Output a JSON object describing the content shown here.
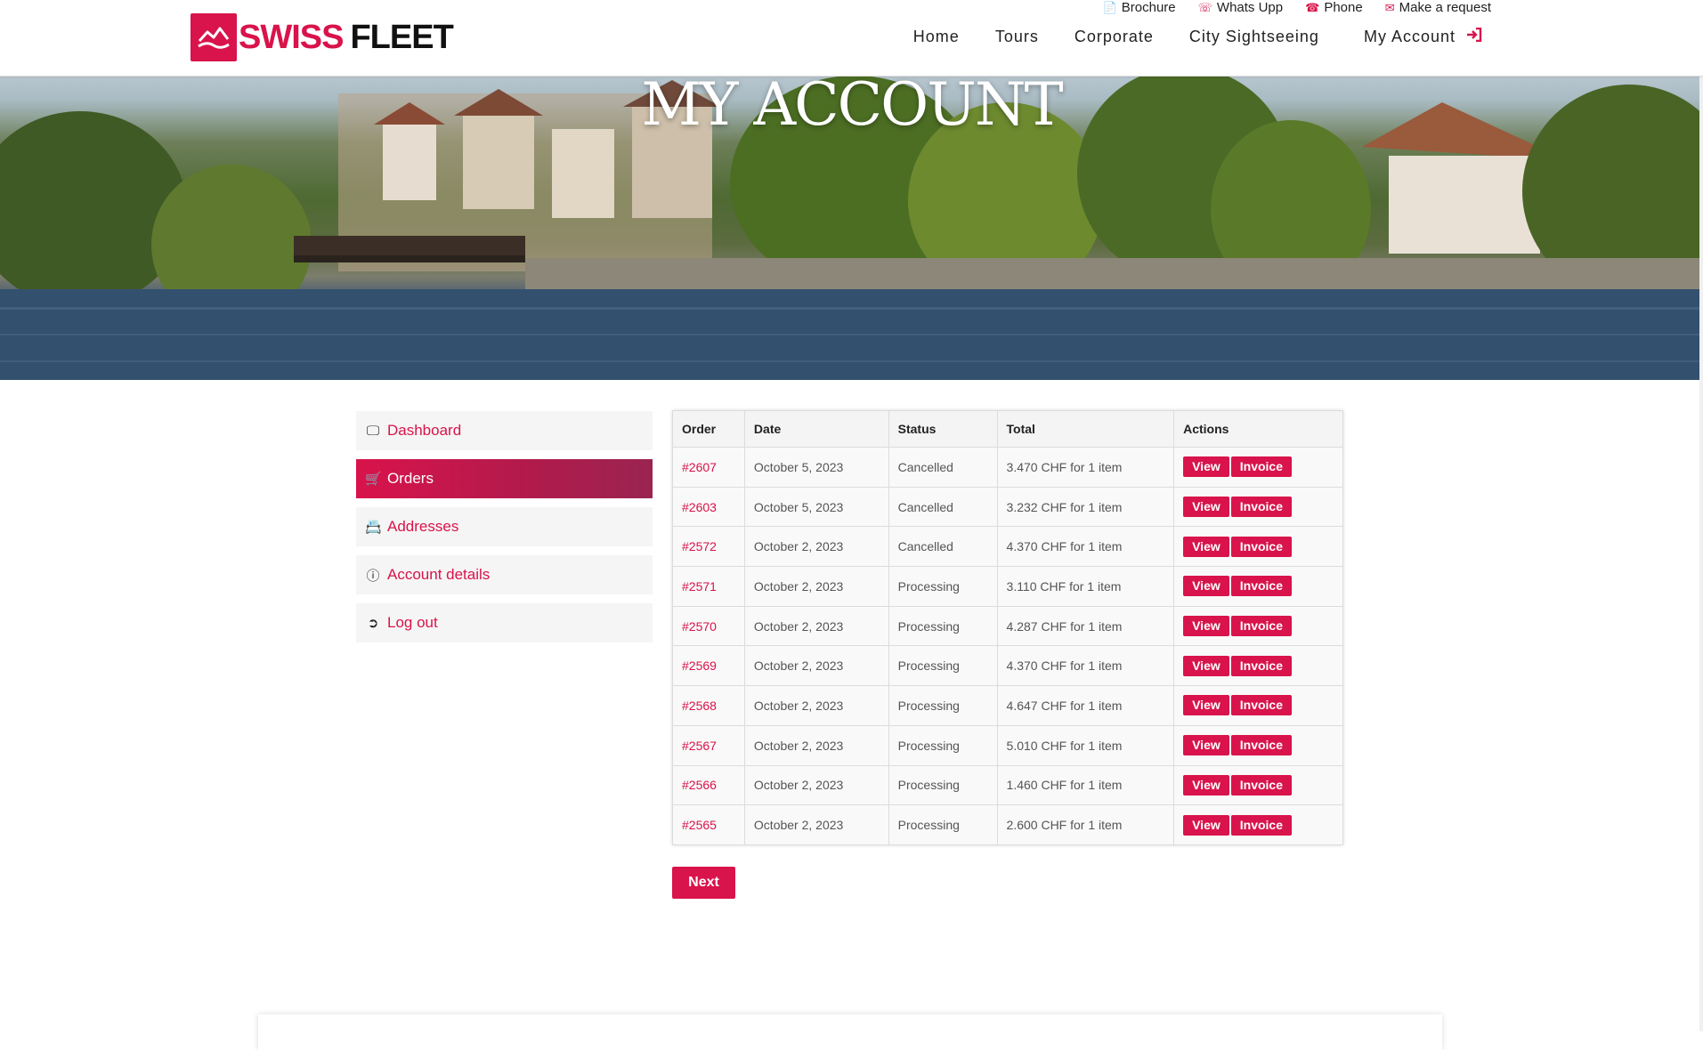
{
  "brand": {
    "part1": "SWISS",
    "part2": "FLEET",
    "color": "#d9134b"
  },
  "topbar": [
    {
      "icon": "file-pdf-icon",
      "label": "Brochure"
    },
    {
      "icon": "whatsapp-icon",
      "label": "Whats Upp"
    },
    {
      "icon": "phone-icon",
      "label": "Phone"
    },
    {
      "icon": "envelope-icon",
      "label": "Make a request"
    }
  ],
  "nav": {
    "items": [
      "Home",
      "Tours",
      "Corporate",
      "City Sightseeing"
    ],
    "account": "My Account"
  },
  "hero": {
    "title": "MY ACCOUNT"
  },
  "sidebar": [
    {
      "icon": "dashboard-icon",
      "label": "Dashboard",
      "active": false
    },
    {
      "icon": "cart-icon",
      "label": "Orders",
      "active": true
    },
    {
      "icon": "address-card-icon",
      "label": "Addresses",
      "active": false
    },
    {
      "icon": "info-icon",
      "label": "Account details",
      "active": false
    },
    {
      "icon": "logout-icon",
      "label": "Log out",
      "active": false
    }
  ],
  "table": {
    "headers": [
      "Order",
      "Date",
      "Status",
      "Total",
      "Actions"
    ],
    "view_label": "View",
    "invoice_label": "Invoice",
    "rows": [
      {
        "order": "#2607",
        "date": "October 5, 2023",
        "status": "Cancelled",
        "total": "3.470 CHF for 1 item"
      },
      {
        "order": "#2603",
        "date": "October 5, 2023",
        "status": "Cancelled",
        "total": "3.232 CHF for 1 item"
      },
      {
        "order": "#2572",
        "date": "October 2, 2023",
        "status": "Cancelled",
        "total": "4.370 CHF for 1 item"
      },
      {
        "order": "#2571",
        "date": "October 2, 2023",
        "status": "Processing",
        "total": "3.110 CHF for 1 item"
      },
      {
        "order": "#2570",
        "date": "October 2, 2023",
        "status": "Processing",
        "total": "4.287 CHF for 1 item"
      },
      {
        "order": "#2569",
        "date": "October 2, 2023",
        "status": "Processing",
        "total": "4.370 CHF for 1 item"
      },
      {
        "order": "#2568",
        "date": "October 2, 2023",
        "status": "Processing",
        "total": "4.647 CHF for 1 item"
      },
      {
        "order": "#2567",
        "date": "October 2, 2023",
        "status": "Processing",
        "total": "5.010 CHF for 1 item"
      },
      {
        "order": "#2566",
        "date": "October 2, 2023",
        "status": "Processing",
        "total": "1.460 CHF for 1 item"
      },
      {
        "order": "#2565",
        "date": "October 2, 2023",
        "status": "Processing",
        "total": "2.600 CHF for 1 item"
      }
    ]
  },
  "pagination": {
    "next_label": "Next"
  }
}
